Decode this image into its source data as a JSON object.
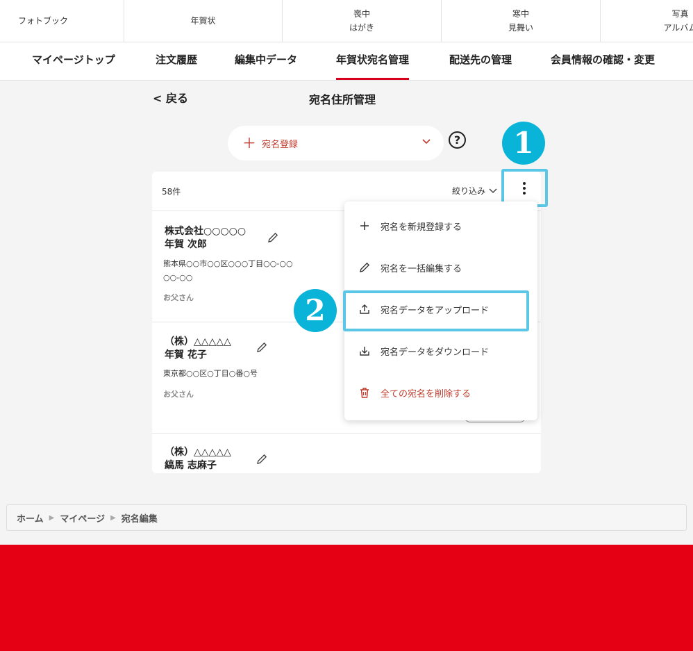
{
  "top_categories": [
    {
      "line1": "フォトブック",
      "line2": ""
    },
    {
      "line1": "年賀状",
      "line2": ""
    },
    {
      "line1": "喪中",
      "line2": "はがき"
    },
    {
      "line1": "寒中",
      "line2": "見舞い"
    },
    {
      "line1": "写真",
      "line2": "アルバム"
    }
  ],
  "nav": {
    "items": [
      "マイページトップ",
      "注文履歴",
      "編集中データ",
      "年賀状宛名管理",
      "配送先の管理",
      "会員情報の確認・変更"
    ],
    "active_index": 3
  },
  "header": {
    "back_label": "< 戻る",
    "title": "宛名住所管理"
  },
  "register": {
    "label": "宛名登録",
    "help": "?"
  },
  "badges": {
    "one": "1",
    "two": "2"
  },
  "list": {
    "count": "58件",
    "filter_label": "絞り込み",
    "items": [
      {
        "company": "株式会社○○○○○",
        "name": "年賀 次郎",
        "address_line1": "熊本県○○市○○区○○○丁目○○-○○",
        "address_line2": "○○-○○",
        "relation": "お父さん"
      },
      {
        "company": "（株）△△△△△",
        "name": "年賀 花子",
        "address_line1": "東京都○○区○丁目○番○号",
        "address_line2": "",
        "relation": "お父さん"
      },
      {
        "company": "（株）△△△△△",
        "name": "縞馬 志麻子",
        "address_line1": "",
        "address_line2": "",
        "relation": ""
      }
    ]
  },
  "menu": {
    "items": [
      {
        "label": "宛名を新規登録する",
        "icon": "plus-icon"
      },
      {
        "label": "宛名を一括編集する",
        "icon": "pencil-icon"
      },
      {
        "label": "宛名データをアップロード",
        "icon": "upload-icon"
      },
      {
        "label": "宛名データをダウンロード",
        "icon": "download-icon"
      },
      {
        "label": "全ての宛名を削除する",
        "icon": "trash-icon"
      }
    ]
  },
  "breadcrumb": [
    "ホーム",
    "マイページ",
    "宛名編集"
  ],
  "colors": {
    "accent": "#d6001c",
    "highlight": "#5bc7e6",
    "badge": "#0ab4d8",
    "footer": "#e60014"
  }
}
